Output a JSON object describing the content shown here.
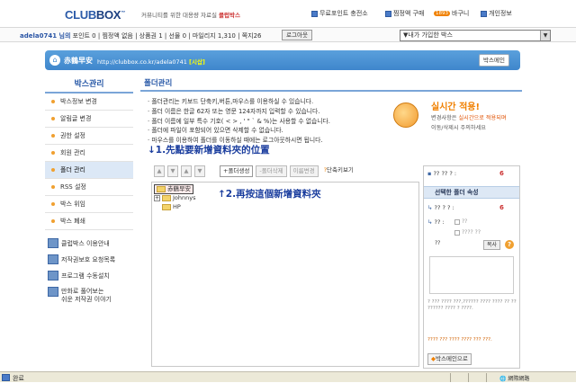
{
  "header": {
    "logo_main": "CLUB",
    "logo_box": "BOX",
    "logo_suffix": "™",
    "tagline": "커뮤니티를 위한 대용량 자료실",
    "tagline_em": "클럽박스",
    "links": [
      "무료포인트 충전소",
      "찜정액 구매",
      "바구니",
      "개인정보"
    ],
    "basket_count": "1893"
  },
  "userbar": {
    "username": "adela0741 님의",
    "info": "포인트 0 | 찜정액 없음 | 상품권 1 | 선물 0 | 마일리지 1,310 | 쪽지26",
    "logout": "로그아웃",
    "box_select": "▼내가 가입한 박스"
  },
  "urlbar": {
    "box_name": "赤鶴早安",
    "url_prefix": "http://clubbox.co.kr/adela0741",
    "url_tag": "[시삽]",
    "box_main": "박스메인"
  },
  "sidebar": {
    "title": "박스관리",
    "items": [
      "박스정보 변경",
      "알림글 변경",
      "권한 설정",
      "회원 관리",
      "폴더 관리",
      "RSS 설정",
      "박스 위임",
      "박스 폐쇄"
    ],
    "active_index": 4,
    "footer": [
      "클럽박스 이용안내",
      "저작권보호 요청목록",
      "프로그램 수동설치"
    ],
    "footer_multi": [
      "만화로 풀어보는",
      "쉬운 저작권 이야기"
    ]
  },
  "main": {
    "title": "폴더관리",
    "notes": [
      "폴더관리는 키보드 단축키,버튼,마우스를 이용하실 수 있습니다.",
      "폴더 이름은 한글 62자 또는 영문 124자까지 입력할 수 있습니다.",
      "폴더 이름에 일부 특수 기호( < > , ' \" ` & %)는 사용할 수 없습니다.",
      "폴더에 파일이 포함되어 있으면 삭제할 수 없습니다.",
      "마우스를 이용하여 폴더를 이동하실 때에는 로그아웃하시면 됩니다."
    ],
    "realtime_title": "실시간 적용!",
    "realtime_l1": "변경사항은",
    "realtime_l1_em": "실시간으로 적용되며",
    "realtime_l2": "이동/삭제시 주의하세요",
    "annotation1": "↓1.先點要新增資料夾的位置",
    "annotation2": "↑2.再按這個新增資料夾",
    "toolbar": {
      "btn_up": "▲",
      "btn_down": "▼",
      "btn_top": "▲",
      "btn_bottom": "▼",
      "create": "+폴더생성",
      "delete": "-폴더삭제",
      "rename": "이름변경",
      "shortcut": "단축키보기"
    },
    "tree": {
      "root": "赤鶴早安",
      "children": [
        "Johnnys",
        "HP"
      ]
    }
  },
  "right_panel": {
    "count_label": "?? ?? ? :",
    "count_value": "6",
    "section_title": "선택한 폴더 속성",
    "row1_label": "?? ? ? :",
    "row1_value": "6",
    "row2_label": "?? :",
    "row2_opt1": "??",
    "row2_opt2": "????  ??",
    "copy_label": "??",
    "copy_btn": "복사",
    "help": "?",
    "desc": "? ??? ???? ???,?????? ???? ???? ?? ?? ?????? ???? ? ????.",
    "warn": "???? ??? ???? ???? ??? ???.",
    "box_main_btn": "박스메인으로"
  },
  "statusbar": {
    "done": "완료",
    "zone": "網際網路"
  },
  "colors": {
    "brand_blue": "#2a5aa8",
    "urlbar": "#4a93d4",
    "annotation": "#1a3d9e",
    "accent_orange": "#f08000"
  }
}
